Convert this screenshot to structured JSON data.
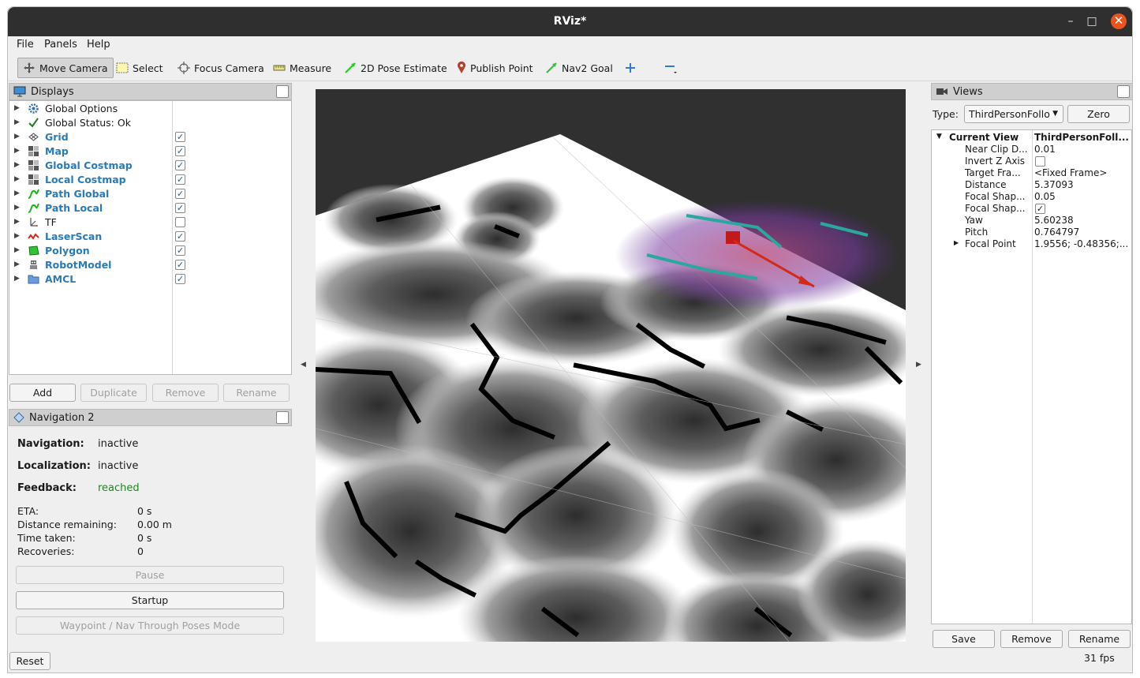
{
  "window": {
    "title": "RViz*",
    "minimize": "–",
    "maximize": "□",
    "close": "✕"
  },
  "menu": [
    "File",
    "Panels",
    "Help"
  ],
  "toolbar": {
    "tools": [
      {
        "label": "Move Camera",
        "icon": "move-camera-icon",
        "active": true
      },
      {
        "label": "Select",
        "icon": "select-icon"
      },
      {
        "label": "Focus Camera",
        "icon": "focus-camera-icon"
      },
      {
        "label": "Measure",
        "icon": "measure-icon"
      },
      {
        "label": "2D Pose Estimate",
        "icon": "pose-estimate-icon"
      },
      {
        "label": "Publish Point",
        "icon": "publish-point-icon"
      },
      {
        "label": "Nav2 Goal",
        "icon": "nav2-goal-icon"
      }
    ],
    "add_icon": "plus-icon",
    "remove_icon": "minus-icon"
  },
  "displays": {
    "title": "Displays",
    "items": [
      {
        "label": "Global Options",
        "icon": "gear-icon",
        "bold": false,
        "checkbox": null
      },
      {
        "label": "Global Status: Ok",
        "icon": "checkmark-icon",
        "bold": false,
        "checkbox": null
      },
      {
        "label": "Grid",
        "icon": "grid-icon",
        "bold": true,
        "checkbox": true
      },
      {
        "label": "Map",
        "icon": "map-icon",
        "bold": true,
        "checkbox": true
      },
      {
        "label": "Global Costmap",
        "icon": "map-icon",
        "bold": true,
        "checkbox": true
      },
      {
        "label": "Local Costmap",
        "icon": "map-icon",
        "bold": true,
        "checkbox": true
      },
      {
        "label": "Path Global",
        "icon": "path-icon",
        "bold": true,
        "checkbox": true
      },
      {
        "label": "Path Local",
        "icon": "path-icon",
        "bold": true,
        "checkbox": true
      },
      {
        "label": "TF",
        "icon": "tf-icon",
        "bold": false,
        "checkbox": false
      },
      {
        "label": "LaserScan",
        "icon": "laserscan-icon",
        "bold": true,
        "checkbox": true
      },
      {
        "label": "Polygon",
        "icon": "polygon-icon",
        "bold": true,
        "checkbox": true
      },
      {
        "label": "RobotModel",
        "icon": "robot-model-icon",
        "bold": true,
        "checkbox": true
      },
      {
        "label": "AMCL",
        "icon": "folder-icon",
        "bold": true,
        "checkbox": true
      }
    ],
    "buttons": {
      "add": "Add",
      "duplicate": "Duplicate",
      "remove": "Remove",
      "rename": "Rename"
    }
  },
  "nav2": {
    "title": "Navigation 2",
    "navigation_label": "Navigation:",
    "navigation_value": "inactive",
    "localization_label": "Localization:",
    "localization_value": "inactive",
    "feedback_label": "Feedback:",
    "feedback_value": "reached",
    "eta_label": "ETA:",
    "eta_value": "0 s",
    "distance_label": "Distance remaining:",
    "distance_value": "0.00 m",
    "time_label": "Time taken:",
    "time_value": "0 s",
    "recoveries_label": "Recoveries:",
    "recoveries_value": "0",
    "pause": "Pause",
    "startup": "Startup",
    "waypoint": "Waypoint / Nav Through Poses Mode"
  },
  "reset": "Reset",
  "views": {
    "title": "Views",
    "type_label": "Type:",
    "type_value": "ThirdPersonFollo",
    "zero": "Zero",
    "current_view": {
      "key": "Current View",
      "value": "ThirdPersonFoll..."
    },
    "props": [
      {
        "key": "Near Clip D...",
        "value": "0.01"
      },
      {
        "key": "Invert Z Axis",
        "value": "",
        "checkbox": false
      },
      {
        "key": "Target Fra...",
        "value": "<Fixed Frame>"
      },
      {
        "key": "Distance",
        "value": "5.37093"
      },
      {
        "key": "Focal Shap...",
        "value": "0.05"
      },
      {
        "key": "Focal Shap...",
        "value": "",
        "checkbox": true
      },
      {
        "key": "Yaw",
        "value": "5.60238"
      },
      {
        "key": "Pitch",
        "value": "0.764797"
      },
      {
        "key": "Focal Point",
        "value": "1.9556; -0.48356;...",
        "expandable": true
      }
    ],
    "buttons": {
      "save": "Save",
      "remove": "Remove",
      "rename": "Rename"
    }
  },
  "fps": "31 fps",
  "colors": {
    "accent": "#2a7ab8",
    "feedback": "#1a8a1a",
    "titlebar": "#2f2f2f",
    "close": "#e9541f"
  }
}
